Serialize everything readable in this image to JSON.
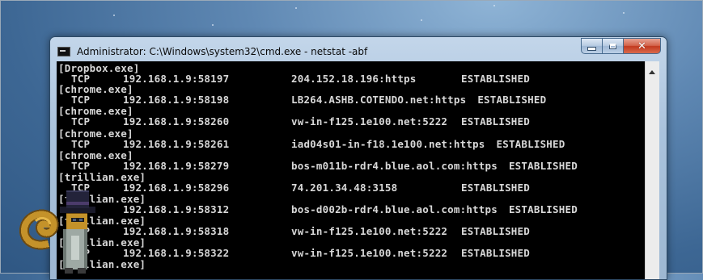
{
  "window": {
    "title": "Administrator: C:\\Windows\\system32\\cmd.exe - netstat  -abf"
  },
  "console": {
    "lines": [
      {
        "type": "exe",
        "text": "[Dropbox.exe]"
      },
      {
        "type": "conn",
        "proto": "TCP",
        "local": "192.168.1.9:58197",
        "foreign": "204.152.18.196:https",
        "state": "ESTABLISHED"
      },
      {
        "type": "exe",
        "text": "[chrome.exe]"
      },
      {
        "type": "conn",
        "proto": "TCP",
        "local": "192.168.1.9:58198",
        "foreign": "LB264.ASHB.COTENDO.net:https",
        "state": "ESTABLISHED"
      },
      {
        "type": "exe",
        "text": "[chrome.exe]"
      },
      {
        "type": "conn",
        "proto": "TCP",
        "local": "192.168.1.9:58260",
        "foreign": "vw-in-f125.1e100.net:5222",
        "state": "ESTABLISHED"
      },
      {
        "type": "exe",
        "text": "[chrome.exe]"
      },
      {
        "type": "conn",
        "proto": "TCP",
        "local": "192.168.1.9:58261",
        "foreign": "iad04s01-in-f18.1e100.net:https",
        "state": "ESTABLISHED"
      },
      {
        "type": "exe",
        "text": "[chrome.exe]"
      },
      {
        "type": "conn",
        "proto": "TCP",
        "local": "192.168.1.9:58279",
        "foreign": "bos-m011b-rdr4.blue.aol.com:https",
        "state": "ESTABLISHED"
      },
      {
        "type": "exe",
        "text": "[trillian.exe]"
      },
      {
        "type": "conn",
        "proto": "TCP",
        "local": "192.168.1.9:58296",
        "foreign": "74.201.34.48:3158",
        "state": "ESTABLISHED"
      },
      {
        "type": "exe",
        "text": "[trillian.exe]"
      },
      {
        "type": "conn",
        "proto": "TCP",
        "local": "192.168.1.9:58312",
        "foreign": "bos-d002b-rdr4.blue.aol.com:https",
        "state": "ESTABLISHED"
      },
      {
        "type": "exe",
        "text": "[trillian.exe]"
      },
      {
        "type": "conn",
        "proto": "TCP",
        "local": "192.168.1.9:58318",
        "foreign": "vw-in-f125.1e100.net:5222",
        "state": "ESTABLISHED"
      },
      {
        "type": "exe",
        "text": "[trillian.exe]"
      },
      {
        "type": "conn",
        "proto": "TCP",
        "local": "192.168.1.9:58322",
        "foreign": "vw-in-f125.1e100.net:5222",
        "state": "ESTABLISHED"
      },
      {
        "type": "exe",
        "text": "[trillian.exe]"
      }
    ]
  },
  "icons": {
    "window_icon": "cmd-icon",
    "minimize": "minimize-icon",
    "maximize": "maximize-icon",
    "close": "close-icon",
    "scroll_up": "scroll-up-arrow-icon",
    "mascot": "squirrel-spy-mascot"
  },
  "colors": {
    "console_bg": "#000000",
    "console_text": "#d8d8d8",
    "close_button": "#c23a1f"
  }
}
